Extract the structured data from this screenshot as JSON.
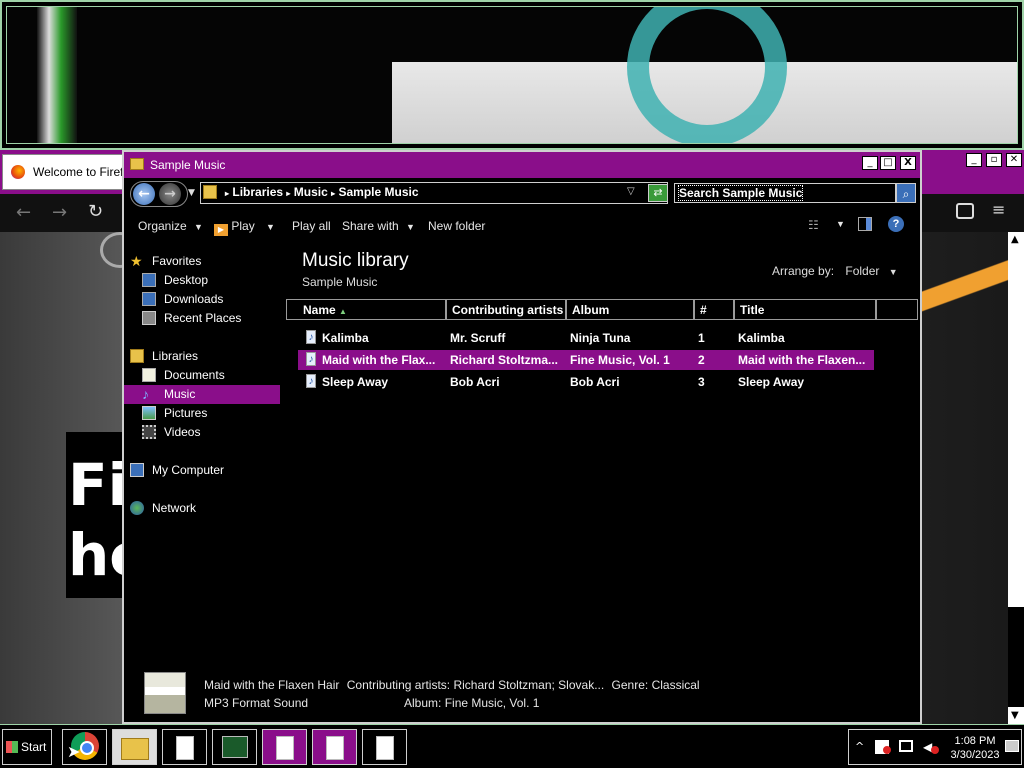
{
  "firefox": {
    "tab_title": "Welcome to Firefox",
    "hero_text_1": "Fi",
    "hero_text_2": "he"
  },
  "window": {
    "title": "Sample Music",
    "minimize": "_",
    "maximize": "□",
    "close": "X"
  },
  "address": {
    "breadcrumb": [
      "Libraries",
      "Music",
      "Sample Music"
    ],
    "search_placeholder": "Search Sample Music"
  },
  "toolbar": {
    "organize": "Organize",
    "play": "Play",
    "play_all": "Play all",
    "share_with": "Share with",
    "new_folder": "New folder"
  },
  "nav": {
    "favorites": "Favorites",
    "desktop": "Desktop",
    "downloads": "Downloads",
    "recent_places": "Recent Places",
    "libraries": "Libraries",
    "documents": "Documents",
    "music": "Music",
    "pictures": "Pictures",
    "videos": "Videos",
    "my_computer": "My Computer",
    "network": "Network"
  },
  "main": {
    "heading": "Music library",
    "subheading": "Sample Music",
    "arrange_label": "Arrange by:",
    "arrange_value": "Folder",
    "columns": [
      "Name",
      "Contributing artists",
      "Album",
      "#",
      "Title"
    ],
    "rows": [
      {
        "name": "Kalimba",
        "artist": "Mr. Scruff",
        "album": "Ninja Tuna",
        "num": "1",
        "title": "Kalimba"
      },
      {
        "name": "Maid with the Flax...",
        "artist": "Richard Stoltzma...",
        "album": "Fine Music, Vol. 1",
        "num": "2",
        "title": "Maid with the Flaxen..."
      },
      {
        "name": "Sleep Away",
        "artist": "Bob Acri",
        "album": "Bob Acri",
        "num": "3",
        "title": "Sleep Away"
      }
    ],
    "selected_row": 1
  },
  "details": {
    "title": "Maid with the Flaxen Hair",
    "type": "MP3 Format Sound",
    "artists_label": "Contributing artists:",
    "artists_value": "Richard Stoltzman; Slovak...",
    "genre_label": "Genre:",
    "genre_value": "Classical",
    "album_label": "Album:",
    "album_value": "Fine Music, Vol. 1"
  },
  "taskbar": {
    "start": "Start",
    "time": "1:08 PM",
    "date": "3/30/2023"
  },
  "colors": {
    "accent": "#8a0e8a",
    "border": "#9fd3a8"
  }
}
